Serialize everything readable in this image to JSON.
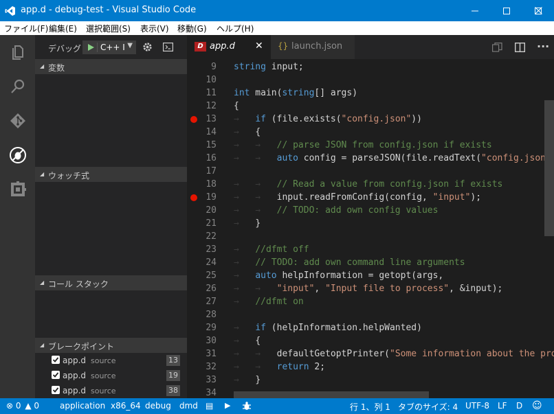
{
  "window": {
    "title": "app.d - debug-test - Visual Studio Code",
    "controls": [
      "minimize-icon",
      "maximize-icon",
      "close-icon"
    ]
  },
  "menu": [
    "ファイル(F)",
    "編集(E)",
    "選択範囲(S)",
    "表示(V)",
    "移動(G)",
    "ヘルプ(H)"
  ],
  "activity": [
    "explorer-icon",
    "search-icon",
    "git-icon",
    "debug-icon",
    "extensions-icon"
  ],
  "debug": {
    "label": "デバッグ",
    "config": "C++ I",
    "sections": {
      "variables": "変数",
      "watch": "ウォッチ式",
      "callstack": "コール スタック",
      "breakpoints": "ブレークポイント"
    },
    "breakpoints": [
      {
        "file": "app.d",
        "src": "source",
        "line": "13"
      },
      {
        "file": "app.d",
        "src": "source",
        "line": "19"
      },
      {
        "file": "app.d",
        "src": "source",
        "line": "38"
      }
    ]
  },
  "tabs": [
    {
      "name": "app.d",
      "active": true
    },
    {
      "name": "launch.json",
      "active": false
    }
  ],
  "colors": {
    "accent": "#007acc",
    "keyword": "#569cd6",
    "string": "#ce9178",
    "comment": "#608b4e",
    "breakpoint": "#e51400"
  },
  "code": [
    {
      "n": "9",
      "t": [
        [
          "kw",
          "string"
        ],
        [
          "",
          " input;"
        ]
      ]
    },
    {
      "n": "10",
      "t": []
    },
    {
      "n": "11",
      "t": [
        [
          "kw",
          "int"
        ],
        [
          "",
          " main("
        ],
        [
          "kw",
          "string"
        ],
        [
          "",
          "[] args)"
        ]
      ]
    },
    {
      "n": "12",
      "t": [
        [
          "",
          "{"
        ]
      ]
    },
    {
      "n": "13",
      "bp": true,
      "t": [
        [
          "tab",
          "→   "
        ],
        [
          "kw",
          "if"
        ],
        [
          "",
          " (file.exists("
        ],
        [
          "str",
          "\"config.json\""
        ],
        [
          "",
          "))"
        ]
      ]
    },
    {
      "n": "14",
      "t": [
        [
          "tab",
          "→   "
        ],
        [
          "",
          "{"
        ]
      ]
    },
    {
      "n": "15",
      "t": [
        [
          "tab",
          "→   →   "
        ],
        [
          "com",
          "// parse JSON from config.json if exists"
        ]
      ]
    },
    {
      "n": "16",
      "t": [
        [
          "tab",
          "→   →   "
        ],
        [
          "kw",
          "auto"
        ],
        [
          "",
          " config = parseJSON(file.readText("
        ],
        [
          "str",
          "\"config.json\""
        ],
        [
          "",
          "));"
        ]
      ]
    },
    {
      "n": "17",
      "t": []
    },
    {
      "n": "18",
      "t": [
        [
          "tab",
          "→   →   "
        ],
        [
          "com",
          "// Read a value from config.json if exists"
        ]
      ]
    },
    {
      "n": "19",
      "bp": true,
      "t": [
        [
          "tab",
          "→   →   "
        ],
        [
          "",
          "input.readFromConfig(config, "
        ],
        [
          "str",
          "\"input\""
        ],
        [
          "",
          ");"
        ]
      ]
    },
    {
      "n": "20",
      "t": [
        [
          "tab",
          "→   →   "
        ],
        [
          "com",
          "// TODO: add own config values"
        ]
      ]
    },
    {
      "n": "21",
      "t": [
        [
          "tab",
          "→   "
        ],
        [
          "",
          "}"
        ]
      ]
    },
    {
      "n": "22",
      "t": []
    },
    {
      "n": "23",
      "t": [
        [
          "tab",
          "→   "
        ],
        [
          "com",
          "//dfmt off"
        ]
      ]
    },
    {
      "n": "24",
      "t": [
        [
          "tab",
          "→   "
        ],
        [
          "com",
          "// TODO: add own command line arguments"
        ]
      ]
    },
    {
      "n": "25",
      "t": [
        [
          "tab",
          "→   "
        ],
        [
          "kw",
          "auto"
        ],
        [
          "",
          " helpInformation = getopt(args,"
        ]
      ]
    },
    {
      "n": "26",
      "t": [
        [
          "tab",
          "→   →   "
        ],
        [
          "str",
          "\"input\""
        ],
        [
          "",
          ", "
        ],
        [
          "str",
          "\"Input file to process\""
        ],
        [
          "",
          ", &input);"
        ]
      ]
    },
    {
      "n": "27",
      "t": [
        [
          "tab",
          "→   "
        ],
        [
          "com",
          "//dfmt on"
        ]
      ]
    },
    {
      "n": "28",
      "t": []
    },
    {
      "n": "29",
      "t": [
        [
          "tab",
          "→   "
        ],
        [
          "kw",
          "if"
        ],
        [
          "",
          " (helpInformation.helpWanted)"
        ]
      ]
    },
    {
      "n": "30",
      "t": [
        [
          "tab",
          "→   "
        ],
        [
          "",
          "{"
        ]
      ]
    },
    {
      "n": "31",
      "t": [
        [
          "tab",
          "→   →   "
        ],
        [
          "",
          "defaultGetoptPrinter("
        ],
        [
          "str",
          "\"Some information about the prog"
        ]
      ]
    },
    {
      "n": "32",
      "t": [
        [
          "tab",
          "→   →   "
        ],
        [
          "kw",
          "return"
        ],
        [
          "",
          " 2;"
        ]
      ]
    },
    {
      "n": "33",
      "t": [
        [
          "tab",
          "→   "
        ],
        [
          "",
          "}"
        ]
      ]
    },
    {
      "n": "34",
      "t": []
    }
  ],
  "status": {
    "errors": "0",
    "warnings": "0",
    "items": [
      "application",
      "x86_64",
      "debug",
      "dmd"
    ],
    "position": "行 1、列 1",
    "tabsize": "タブのサイズ: 4",
    "encoding": "UTF-8",
    "eol": "LF",
    "lang": "D"
  }
}
